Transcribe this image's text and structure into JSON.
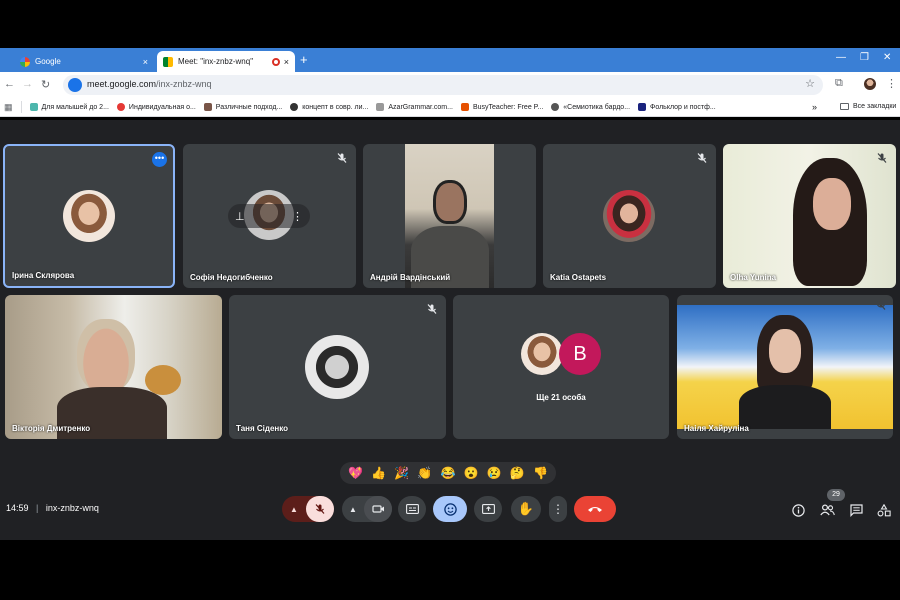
{
  "browser": {
    "tabs": [
      {
        "label": "Google",
        "close": "×"
      },
      {
        "label": "Meet: \"inx-znbz-wnq\"",
        "close": "×"
      }
    ],
    "new_tab": "+",
    "url_host": "meet.google.com",
    "url_path": "/inx-znbz-wnq",
    "bookmarks": [
      {
        "label": "Для малышей до 2...",
        "color": "#4db6ac"
      },
      {
        "label": "Индивидуальная о...",
        "color": "#e53935"
      },
      {
        "label": "Различные подход...",
        "color": "#795548"
      },
      {
        "label": "концепт в совр. ли...",
        "color": "#333333"
      },
      {
        "label": "AzarGrammar.com...",
        "color": "#999999"
      },
      {
        "label": "BusyTeacher: Free P...",
        "color": "#e65100"
      },
      {
        "label": "«Семиотика бардо...",
        "color": "#555555"
      },
      {
        "label": "Фольклор и постф...",
        "color": "#1a237e"
      }
    ],
    "bookmarks_more": "»",
    "all_bookmarks": "Все закладки"
  },
  "meeting": {
    "participants": [
      {
        "name": "Ірина Склярова"
      },
      {
        "name": "Софія Недогибченко"
      },
      {
        "name": "Андрій Вардінський"
      },
      {
        "name": "Katia Ostapets"
      },
      {
        "name": "Olha Yunina"
      },
      {
        "name": "Вікторія Дмитренко"
      },
      {
        "name": "Таня Сіденко"
      },
      {
        "name": "Наіля Хайруліна"
      }
    ],
    "overflow_initial": "B",
    "overflow_label": "Ще 21 особа",
    "reactions": [
      "💖",
      "👍",
      "🎉",
      "👏",
      "😂",
      "😮",
      "😢",
      "🤔",
      "👎"
    ],
    "time": "14:59",
    "code": "inx-znbz-wnq",
    "people_count": "29"
  },
  "colors": {
    "tab_strip": "#3a7fd5",
    "meet_bg": "#202124",
    "tile_bg": "#3c4043",
    "accent_blue": "#8ab4f8",
    "hangup_red": "#ea4335",
    "mic_off_bg": "#f9dedc",
    "overflow_avatar": "#c2185b"
  }
}
